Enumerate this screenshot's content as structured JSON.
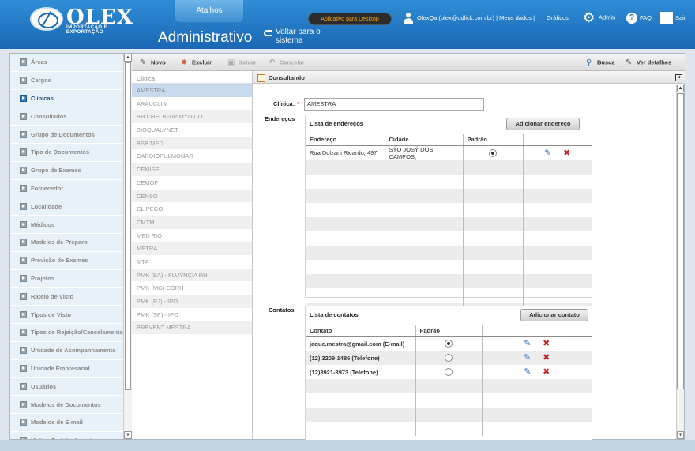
{
  "header": {
    "logo_brand": "OLEX",
    "logo_tagline": "IMPORTAÇÃO E EXPORTAÇÃO",
    "shortcuts_tab": "Atalhos",
    "page_title": "Administrativo",
    "back_link": "Voltar para o sistema",
    "desktop_app_button": "Aplicativo para Desktop",
    "user_info": "OlexQa (olex@ddlick.com.br) | Meus dados  |",
    "charts_link": "Gráficos",
    "admin_link": "Admin",
    "faq_link": "FAQ",
    "exit_link": "Sair"
  },
  "sidebar": {
    "items": [
      {
        "label": "Áreas"
      },
      {
        "label": "Cargos"
      },
      {
        "label": "Clínicas"
      },
      {
        "label": "Consultados"
      },
      {
        "label": "Grupo de Documentos"
      },
      {
        "label": "Tipo de Documentos"
      },
      {
        "label": "Grupo de Exames"
      },
      {
        "label": "Fornecedor"
      },
      {
        "label": "Localidade"
      },
      {
        "label": "Médicos"
      },
      {
        "label": "Modelos de Preparo"
      },
      {
        "label": "Previsão de Exames"
      },
      {
        "label": "Projetos"
      },
      {
        "label": "Rateio de Visto"
      },
      {
        "label": "Tipos de Visto"
      },
      {
        "label": "Tipos de Rejeição/Cancelamento"
      },
      {
        "label": "Unidade de Acompanhamento"
      },
      {
        "label": "Unidade Empresarial"
      },
      {
        "label": "Usuários"
      },
      {
        "label": "Modelos de Documentos"
      },
      {
        "label": "Modelos de E-mail"
      },
      {
        "label": "Motivo Pedido de visto"
      }
    ],
    "active": "Clínicas"
  },
  "toolbar": {
    "new": "Novo",
    "delete": "Excluir",
    "save": "Salvar",
    "cancel": "Cancelar",
    "search": "Busca",
    "details": "Ver detalhes"
  },
  "list": {
    "header": "Clínica",
    "items": [
      "AMESTRA",
      "ARAUCLIN",
      "BH CHECK-UP MÝDICO",
      "BIOQUALYNET",
      "BSB MED",
      "CARDIOPULMONAR",
      "CEMISE",
      "CEMOF",
      "CENSO",
      "CLIPEGO",
      "CMTM",
      "MED RIO",
      "METRA",
      "MTA",
      "PMK (BA) - FLUÝNCIA RH",
      "PMK (MG) CORH",
      "PMK (RJ) - IPO",
      "PMK (SP) - IPO",
      "PREVENT MESTRA"
    ]
  },
  "detail": {
    "panel_title": "Consultando",
    "clinic_label": "Clínica:",
    "clinic_value": "AMESTRA",
    "addresses_label": "Endereços",
    "addresses_box_title": "Lista de endereços",
    "add_address_button": "Adicionar endereço",
    "address_columns": [
      "Endereço",
      "Cidade",
      "Padrão"
    ],
    "addresses": [
      {
        "endereco": "Rua Dolzani Ricardo, 497",
        "cidade": "SÝO JOSÝ DOS CAMPOS,",
        "padrao": true
      }
    ],
    "contacts_label": "Contatos",
    "contacts_box_title": "Lista de contatos",
    "add_contact_button": "Adicionar contato",
    "contact_columns": [
      "Contato",
      "Padrão"
    ],
    "contacts": [
      {
        "contato": "jaque.mestra@gmail.com (E-mail)",
        "padrao": true
      },
      {
        "contato": "(12) 3209-1486 (Telefone)",
        "padrao": false
      },
      {
        "contato": "(12)3921-3973 (Telefone)",
        "padrao": false
      }
    ]
  }
}
